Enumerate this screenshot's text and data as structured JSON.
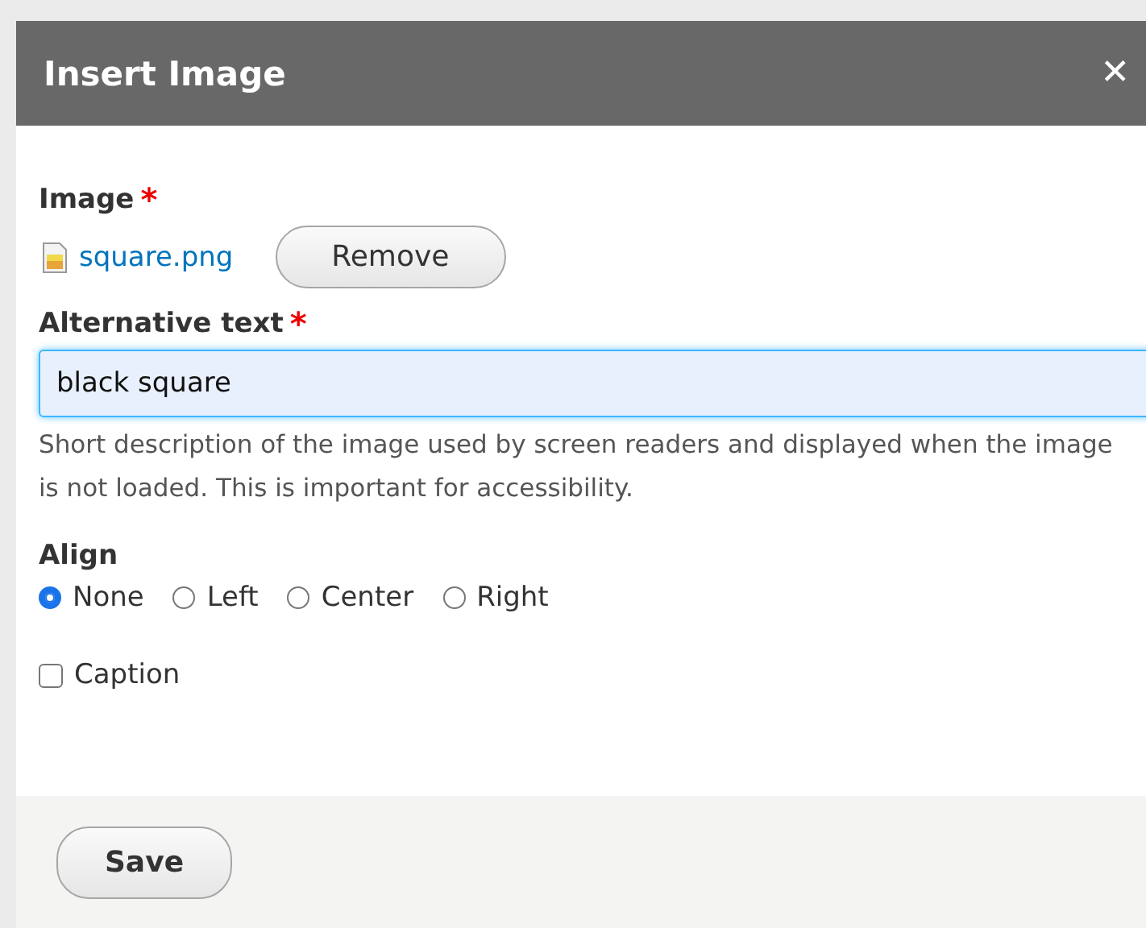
{
  "dialog": {
    "title": "Insert Image",
    "close": "✕"
  },
  "image": {
    "label": "Image",
    "required_mark": "*",
    "filename": "square.png",
    "remove_button": "Remove"
  },
  "alt_text": {
    "label": "Alternative text",
    "required_mark": "*",
    "value": "black square",
    "focused": true,
    "description": "Short description of the image used by screen readers and displayed when the image is not loaded. This is important for accessibility."
  },
  "align": {
    "label": "Align",
    "options": [
      {
        "label": "None",
        "selected": true
      },
      {
        "label": "Left",
        "selected": false
      },
      {
        "label": "Center",
        "selected": false
      },
      {
        "label": "Right",
        "selected": false
      }
    ]
  },
  "caption": {
    "label": "Caption",
    "checked": false
  },
  "buttons": [
    "Save"
  ]
}
